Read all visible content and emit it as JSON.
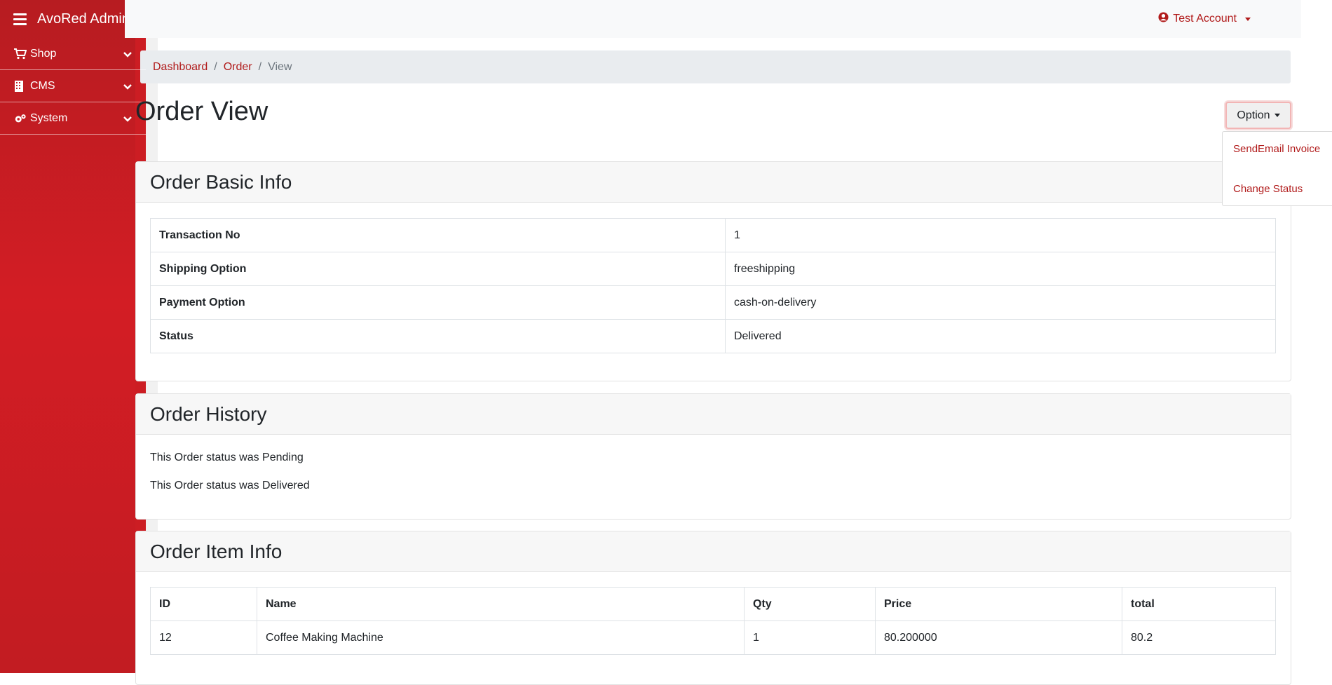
{
  "app": {
    "brand": "AvoRed Admin"
  },
  "sidebar": {
    "items": [
      {
        "label": "Shop",
        "icon": "cart-icon"
      },
      {
        "label": "CMS",
        "icon": "building-icon"
      },
      {
        "label": "System",
        "icon": "gears-icon"
      }
    ]
  },
  "topbar": {
    "account": "Test Account",
    "account_icon": "user-circle-icon"
  },
  "breadcrumb": {
    "dashboard": "Dashboard",
    "order": "Order",
    "current": "View"
  },
  "page": {
    "title": "Order View"
  },
  "option_menu": {
    "button": "Option",
    "items": [
      "SendEmail Invoice",
      "Change Status"
    ]
  },
  "basic_info": {
    "title": "Order Basic Info",
    "rows": [
      {
        "label": "Transaction No",
        "value": "1"
      },
      {
        "label": "Shipping Option",
        "value": "freeshipping"
      },
      {
        "label": "Payment Option",
        "value": "cash-on-delivery"
      },
      {
        "label": "Status",
        "value": "Delivered"
      }
    ]
  },
  "history": {
    "title": "Order History",
    "lines": [
      "This Order status was Pending",
      "This Order status was Delivered"
    ]
  },
  "items_info": {
    "title": "Order Item Info",
    "columns": [
      "ID",
      "Name",
      "Qty",
      "Price",
      "total"
    ],
    "rows": [
      [
        "12",
        "Coffee Making Machine",
        "1",
        "80.200000",
        "80.2"
      ]
    ]
  },
  "colors": {
    "accent": "#b11b1b",
    "sidebar": "#c91d23"
  }
}
